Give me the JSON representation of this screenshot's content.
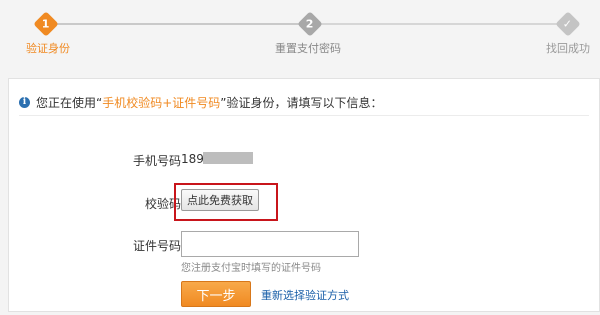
{
  "steps": [
    {
      "number": "1",
      "label": "验证身份",
      "state": "active"
    },
    {
      "number": "2",
      "label": "重置支付密码",
      "state": "pending"
    },
    {
      "number": "",
      "label": "找回成功",
      "state": "pending",
      "icon": "check-icon"
    }
  ],
  "notice": {
    "prefix": "您正在使用“",
    "highlight": "手机校验码+证件号码",
    "suffix": "”验证身份，请填写以下信息：",
    "icon": "info-icon"
  },
  "form": {
    "phone_label": "手机号码",
    "phone_value": "189",
    "code_label": "校验码",
    "get_code_button": "点此免费获取",
    "id_label": "证件号码",
    "id_placeholder": "",
    "id_hint": "您注册支付宝时填写的证件号码",
    "next_button": "下一步",
    "reselect_link": "重新选择验证方式"
  },
  "colors": {
    "accent": "#f08a22",
    "link": "#1a5fa8",
    "highlight_box": "#c8151b"
  }
}
